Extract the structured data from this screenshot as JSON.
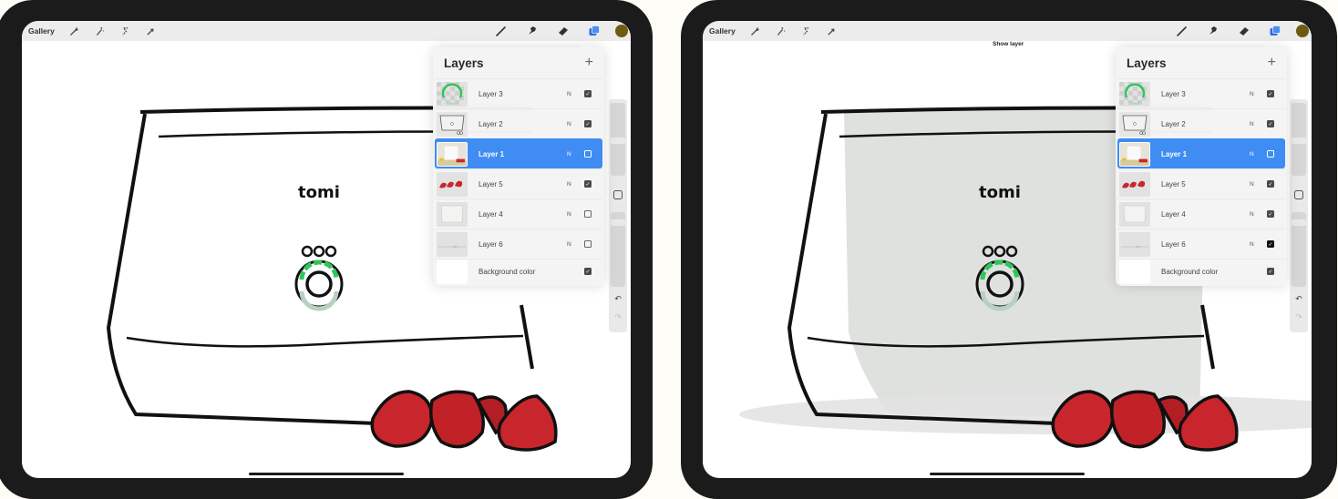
{
  "devices": [
    {
      "id": "left",
      "toolbar": {
        "gallery_label": "Gallery",
        "left_tools": [
          "wrench-icon",
          "magic-wand-icon",
          "selection-icon",
          "transform-arrow-icon"
        ],
        "right_tools": [
          "brush-icon",
          "smudge-icon",
          "eraser-icon",
          "layers-icon"
        ],
        "active_tool": "layers-icon",
        "current_color": "#6f5a12"
      },
      "tooltip": "",
      "canvas": {
        "air_fryer_filled": false,
        "brand_text": "tomi"
      },
      "layers_panel": {
        "title": "Layers",
        "add_symbol": "+",
        "layers": [
          {
            "name": "Layer 3",
            "blend": "N",
            "visible": true,
            "selected": false,
            "thumb": "ring"
          },
          {
            "name": "Layer 2",
            "blend": "N",
            "visible": true,
            "selected": false,
            "thumb": "outline"
          },
          {
            "name": "Layer 1",
            "blend": "N",
            "visible": false,
            "selected": true,
            "thumb": "photo"
          },
          {
            "name": "Layer 5",
            "blend": "N",
            "visible": true,
            "selected": false,
            "thumb": "strawberries"
          },
          {
            "name": "Layer 4",
            "blend": "N",
            "visible": false,
            "selected": false,
            "thumb": "body"
          },
          {
            "name": "Layer 6",
            "blend": "N",
            "visible": false,
            "selected": false,
            "thumb": "shadow"
          }
        ],
        "background": {
          "name": "Background color",
          "visible": true
        }
      },
      "sidebar": {
        "undo": "↶",
        "redo": "↷"
      }
    },
    {
      "id": "right",
      "toolbar": {
        "gallery_label": "Gallery",
        "left_tools": [
          "wrench-icon",
          "magic-wand-icon",
          "selection-icon",
          "transform-arrow-icon"
        ],
        "right_tools": [
          "brush-icon",
          "smudge-icon",
          "eraser-icon",
          "layers-icon"
        ],
        "active_tool": "layers-icon",
        "current_color": "#6f5a12"
      },
      "tooltip": "Show layer",
      "canvas": {
        "air_fryer_filled": true,
        "brand_text": "tomi"
      },
      "layers_panel": {
        "title": "Layers",
        "add_symbol": "+",
        "layers": [
          {
            "name": "Layer 3",
            "blend": "N",
            "visible": true,
            "selected": false,
            "thumb": "ring"
          },
          {
            "name": "Layer 2",
            "blend": "N",
            "visible": true,
            "selected": false,
            "thumb": "outline"
          },
          {
            "name": "Layer 1",
            "blend": "N",
            "visible": false,
            "selected": true,
            "thumb": "photo"
          },
          {
            "name": "Layer 5",
            "blend": "N",
            "visible": true,
            "selected": false,
            "thumb": "strawberries"
          },
          {
            "name": "Layer 4",
            "blend": "N",
            "visible": true,
            "selected": false,
            "thumb": "body"
          },
          {
            "name": "Layer 6",
            "blend": "N",
            "visible": true,
            "selected": false,
            "thumb": "shadow",
            "just_toggled": true
          }
        ],
        "background": {
          "name": "Background color",
          "visible": true
        }
      },
      "sidebar": {
        "undo": "↶",
        "redo": "↷"
      }
    }
  ],
  "colors": {
    "accent": "#3f8cf2",
    "ring_green": "#2ec65a",
    "strawberry": "#c8262c",
    "device_frame": "#1c1b1b"
  }
}
